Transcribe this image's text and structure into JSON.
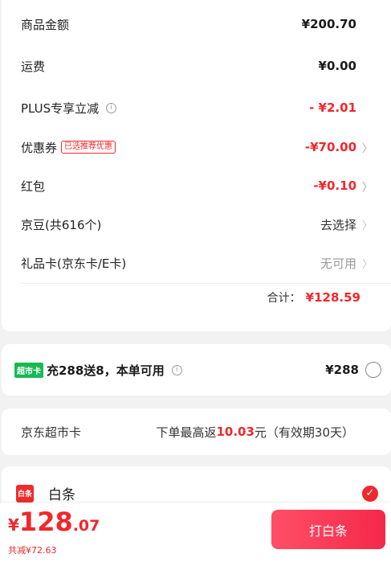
{
  "summary": {
    "rows": [
      {
        "label": "商品金额",
        "value": "¥200.70"
      },
      {
        "label": "运费",
        "value": "¥0.00"
      },
      {
        "label": "PLUS专享立减",
        "value": "- ¥2.01",
        "info_icon": "ⓘ"
      },
      {
        "label": "优惠券",
        "tag": "已选推荐优惠",
        "value": "-¥70.00",
        "chevron": "〉"
      },
      {
        "label": "红包",
        "value": "-¥0.10",
        "chevron": "〉"
      },
      {
        "label": "京豆(共616个)",
        "value": "去选择",
        "chevron": "〉"
      },
      {
        "label": "礼品卡(京东卡/E卡)",
        "value": "无可用",
        "chevron": "〉"
      }
    ],
    "total_label": "合计：",
    "total_value": "¥128.59"
  },
  "recharge": {
    "badge": "超市卡",
    "text": "充288送8，本单可用",
    "info_icon": "ⓘ",
    "price": "¥288",
    "selected": false
  },
  "jd_card": {
    "label": "京东超市卡",
    "desc_prefix": "下单最高返",
    "desc_highlight": "10.03",
    "desc_suffix": "元（有效期30天）"
  },
  "baitiao": {
    "icon_text": "白条",
    "label": "白条",
    "check": "✓",
    "selected": true
  },
  "bottom": {
    "currency": "¥",
    "price_int": "128",
    "price_dec": ".07",
    "saved": "共减¥72.63",
    "pay_button": "打白条"
  },
  "colors": {
    "accent": "#f0282c",
    "badge_green": "#19b955",
    "background": "#f2f2f2"
  }
}
